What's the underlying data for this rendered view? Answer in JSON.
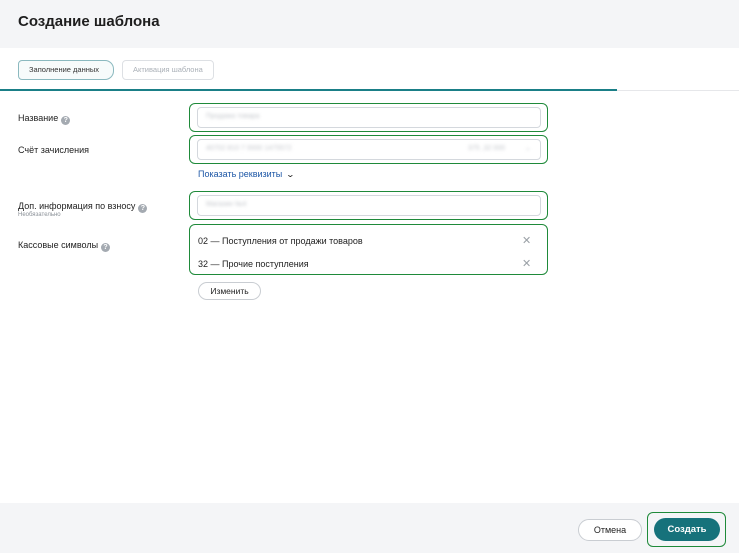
{
  "window": {
    "title": "Создание шаблона"
  },
  "steps": [
    {
      "label": "Заполнение данных"
    },
    {
      "label": "Активация шаблона"
    }
  ],
  "form": {
    "name": {
      "label": "Название",
      "value": "Продажа товара"
    },
    "account": {
      "label": "Счёт зачисления",
      "value": "40702 810 7 0000 1475572",
      "balance": "375 ,32 000"
    },
    "details_link": "Показать реквизиты",
    "extra": {
      "label": "Доп. информация по взносу",
      "hint": "Необязательно",
      "value": "Магазин №4"
    },
    "cash_symbols": {
      "label": "Кассовые символы",
      "items": [
        {
          "label": "02 — Поступления от продажи товаров"
        },
        {
          "label": "32 — Прочие поступления"
        }
      ],
      "change_label": "Изменить"
    }
  },
  "footer": {
    "cancel_label": "Отмена",
    "create_label": "Создать"
  },
  "colors": {
    "accent": "#16727b",
    "highlight": "#1f8a3a",
    "link": "#1d57a6"
  }
}
